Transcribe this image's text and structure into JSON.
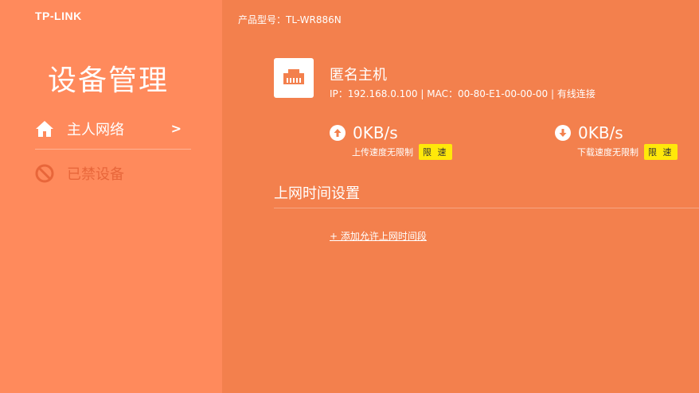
{
  "brand": "TP-LINK",
  "sidebar": {
    "title": "设备管理",
    "items": [
      {
        "label": "主人网络",
        "chevron": ">",
        "icon": "home-icon"
      },
      {
        "label": "已禁设备",
        "icon": "block-icon"
      }
    ]
  },
  "header": {
    "model": "产品型号：TL-WR886N"
  },
  "device": {
    "name": "匿名主机",
    "info": "IP：192.168.0.100 | MAC：00-80-E1-00-00-00 | 有线连接",
    "icon": "ethernet-icon"
  },
  "upload": {
    "value": "0KB/s",
    "status": "上传速度无限制",
    "limit_label": "限 速",
    "icon": "arrow-up-icon"
  },
  "download": {
    "value": "0KB/s",
    "status": "下载速度无限制",
    "limit_label": "限 速",
    "icon": "arrow-down-icon"
  },
  "time_settings": {
    "title": "上网时间设置",
    "add_link": "+ 添加允许上网时间段"
  },
  "colors": {
    "main_bg": "#f3804d",
    "sidebar_bg": "#ff8a5c",
    "limit_btn": "#ffe80a",
    "blocked_text": "#e8663a"
  }
}
